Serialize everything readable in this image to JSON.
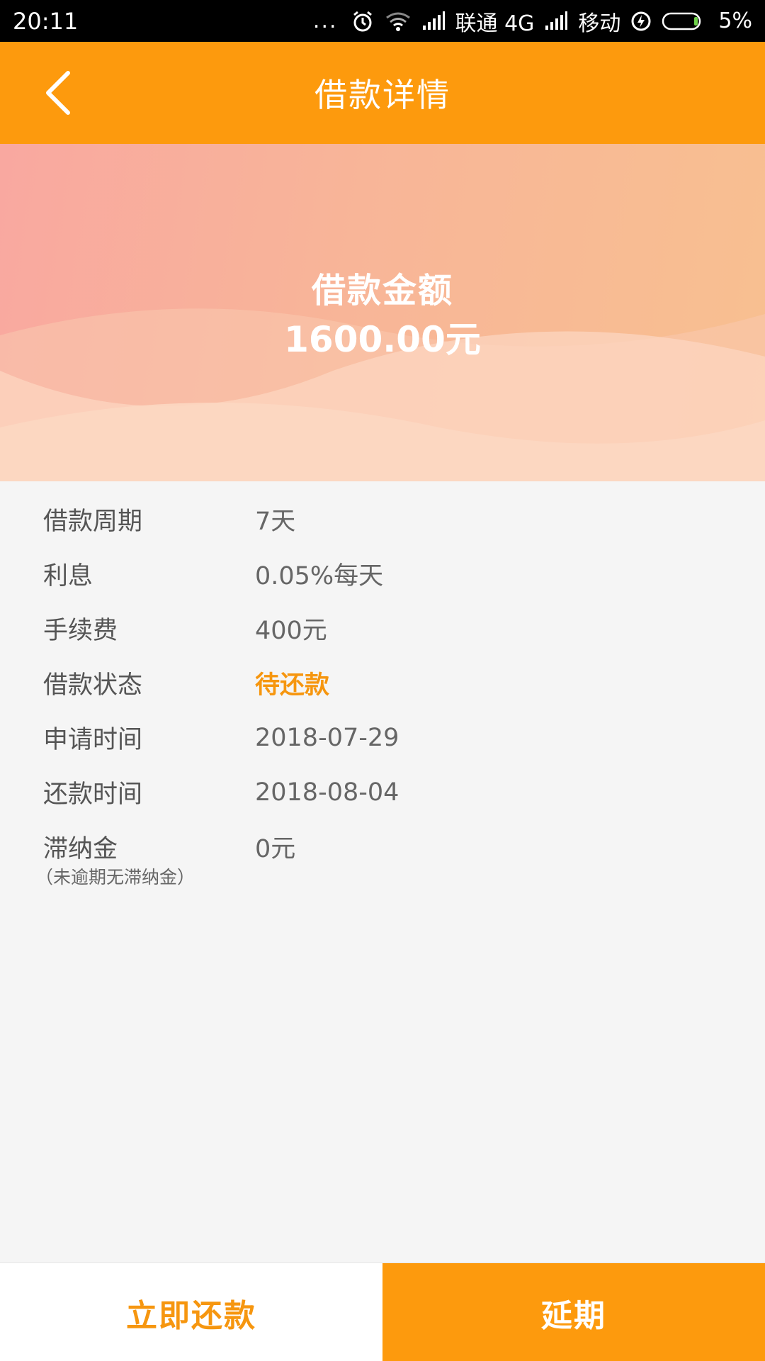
{
  "status_bar": {
    "time": "20:11",
    "dots": "...",
    "carrier1": "联通 4G",
    "carrier2": "移动",
    "battery": "5%"
  },
  "header": {
    "title": "借款详情"
  },
  "banner": {
    "label": "借款金额",
    "amount": "1600.00元"
  },
  "details": {
    "rows": [
      {
        "label": "借款周期",
        "value": "7天"
      },
      {
        "label": "利息",
        "value": "0.05%每天"
      },
      {
        "label": "手续费",
        "value": "400元"
      },
      {
        "label": "借款状态",
        "value": "待还款"
      },
      {
        "label": "申请时间",
        "value": "2018-07-29"
      },
      {
        "label": "还款时间",
        "value": "2018-08-04"
      },
      {
        "label": "滞纳金",
        "value": "0元"
      }
    ],
    "late_fee_note": "（未逾期无滞纳金）"
  },
  "actions": {
    "repay_label": "立即还款",
    "extend_label": "延期"
  },
  "colors": {
    "accent": "#fd9a0d",
    "status": "#f6960f"
  }
}
